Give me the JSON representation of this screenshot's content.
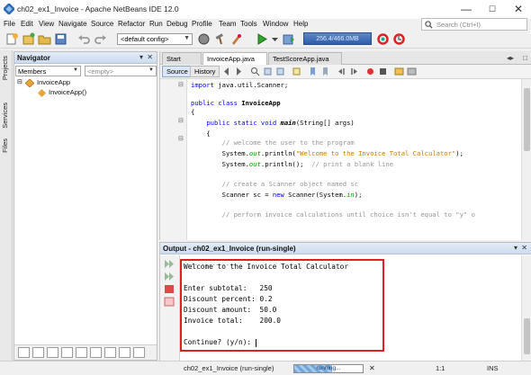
{
  "window": {
    "title": "ch02_ex1_Invoice - Apache NetBeans IDE 12.0",
    "minimize": "—",
    "maximize": "☐",
    "close": "✕"
  },
  "menu": [
    "File",
    "Edit",
    "View",
    "Navigate",
    "Source",
    "Refactor",
    "Run",
    "Debug",
    "Profile",
    "Team",
    "Tools",
    "Window",
    "Help"
  ],
  "search": {
    "placeholder": "Search (Ctrl+I)"
  },
  "toolbar": {
    "config_value": "<default config>",
    "memory_label": "256.4/466.0MB"
  },
  "side_tabs": [
    "Projects",
    "Services",
    "Files"
  ],
  "navigator": {
    "title": "Navigator",
    "filter_value": "Members",
    "empty_combo": "<empty>",
    "tree": [
      {
        "label": "InvoiceApp",
        "icon": "class-icon"
      },
      {
        "label": "InvoiceApp()",
        "icon": "method-icon"
      }
    ]
  },
  "editor": {
    "tabs": [
      {
        "label": "Start Page",
        "active": false
      },
      {
        "label": "InvoiceApp.java",
        "active": true
      },
      {
        "label": "TestScoreApp.java",
        "active": false
      }
    ],
    "subtabs": [
      {
        "label": "Source",
        "active": true
      },
      {
        "label": "History",
        "active": false
      }
    ],
    "code_lines": [
      "import java.util.Scanner;",
      "",
      "public class InvoiceApp",
      "{",
      "    public static void main(String[] args)",
      "    {",
      "        // welcome the user to the program",
      "        System.out.println(\"Welcome to the Invoice Total Calculator\");",
      "        System.out.println();  // print a blank line",
      "",
      "        // create a Scanner object named sc",
      "        Scanner sc = new Scanner(System.in);",
      "",
      "        // perform invoice calculations until choice isn't equal to \"y\" o"
    ]
  },
  "output": {
    "title": "Output - ch02_ex1_Invoice (run-single)",
    "lines": [
      "Welcome to the Invoice Total Calculator",
      "",
      "Enter subtotal:   250",
      "Discount percent: 0.2",
      "Discount amount:  50.0",
      "Invoice total:    200.0",
      "",
      "Continue? (y/n): "
    ]
  },
  "status": {
    "task": "ch02_ex1_Invoice (run-single)",
    "progress_label": "running...",
    "progress": 0.55,
    "position": "1:1",
    "mode": "INS"
  },
  "colors": {
    "highlight_box": "#e02020",
    "keyword": "#0000e6",
    "string": "#ce7b00",
    "comment": "#969696"
  }
}
